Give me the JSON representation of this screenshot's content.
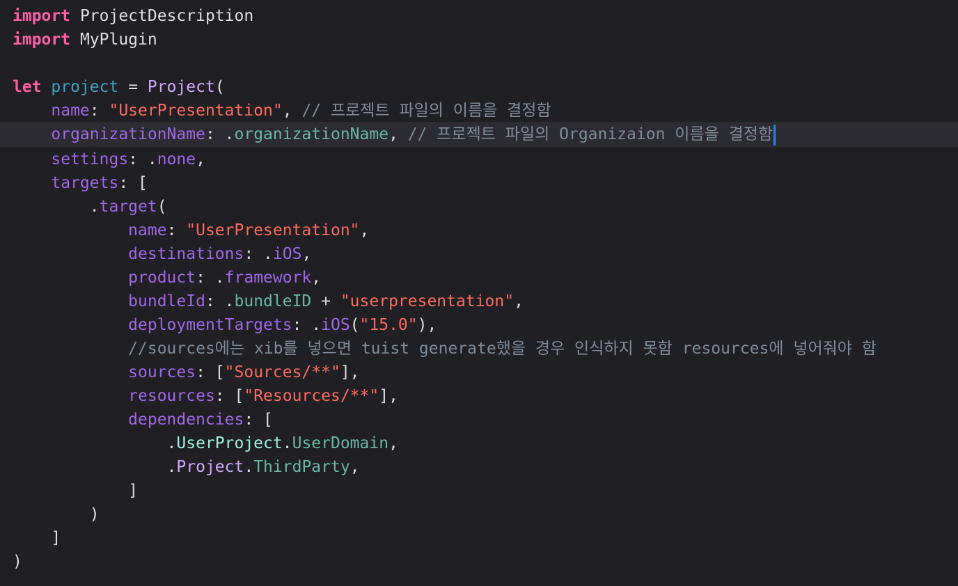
{
  "editor": {
    "cursor_line": 5,
    "colors": {
      "background": "#1f1f24",
      "current_line": "#2b2b31",
      "keyword": "#fc5fa3",
      "string": "#fc6a5d",
      "comment": "#7f8c98",
      "parameter": "#a167e6",
      "cursor": "#2b7fff"
    },
    "lines": [
      [
        [
          "kw",
          "import"
        ],
        [
          "plain",
          " ProjectDescription"
        ]
      ],
      [
        [
          "kw",
          "import"
        ],
        [
          "plain",
          " MyPlugin"
        ]
      ],
      [],
      [
        [
          "kw",
          "let"
        ],
        [
          "plain",
          " "
        ],
        [
          "decl",
          "project"
        ],
        [
          "plain",
          " = "
        ],
        [
          "cls",
          "Project"
        ],
        [
          "plain",
          "("
        ]
      ],
      [
        [
          "plain",
          "    "
        ],
        [
          "param",
          "name"
        ],
        [
          "plain",
          ": "
        ],
        [
          "str",
          "\"UserPresentation\""
        ],
        [
          "plain",
          ", "
        ],
        [
          "cmt",
          "// 프로젝트 파일의 이름을 결정함"
        ]
      ],
      [
        [
          "plain",
          "    "
        ],
        [
          "param",
          "organizationName"
        ],
        [
          "plain",
          ": ."
        ],
        [
          "enum",
          "organizationName"
        ],
        [
          "plain",
          ", "
        ],
        [
          "cmt",
          "// 프로젝트 파일의 Organizaion 이름을 결정함"
        ]
      ],
      [
        [
          "plain",
          "    "
        ],
        [
          "param",
          "settings"
        ],
        [
          "plain",
          ": ."
        ],
        [
          "param",
          "none"
        ],
        [
          "plain",
          ","
        ]
      ],
      [
        [
          "plain",
          "    "
        ],
        [
          "param",
          "targets"
        ],
        [
          "plain",
          ": ["
        ]
      ],
      [
        [
          "plain",
          "        ."
        ],
        [
          "param",
          "target"
        ],
        [
          "plain",
          "("
        ]
      ],
      [
        [
          "plain",
          "            "
        ],
        [
          "param",
          "name"
        ],
        [
          "plain",
          ": "
        ],
        [
          "str",
          "\"UserPresentation\""
        ],
        [
          "plain",
          ","
        ]
      ],
      [
        [
          "plain",
          "            "
        ],
        [
          "param",
          "destinations"
        ],
        [
          "plain",
          ": ."
        ],
        [
          "param",
          "iOS"
        ],
        [
          "plain",
          ","
        ]
      ],
      [
        [
          "plain",
          "            "
        ],
        [
          "param",
          "product"
        ],
        [
          "plain",
          ": ."
        ],
        [
          "param",
          "framework"
        ],
        [
          "plain",
          ","
        ]
      ],
      [
        [
          "plain",
          "            "
        ],
        [
          "param",
          "bundleId"
        ],
        [
          "plain",
          ": ."
        ],
        [
          "enum",
          "bundleID"
        ],
        [
          "plain",
          " + "
        ],
        [
          "str",
          "\"userpresentation\""
        ],
        [
          "plain",
          ","
        ]
      ],
      [
        [
          "plain",
          "            "
        ],
        [
          "param",
          "deploymentTargets"
        ],
        [
          "plain",
          ": ."
        ],
        [
          "param",
          "iOS"
        ],
        [
          "plain",
          "("
        ],
        [
          "str",
          "\"15.0\""
        ],
        [
          "plain",
          "),"
        ]
      ],
      [
        [
          "plain",
          "            "
        ],
        [
          "cmt",
          "//sources에는 xib를 넣으면 tuist generate했을 경우 인식하지 못함 resources에 넣어줘야 함"
        ]
      ],
      [
        [
          "plain",
          "            "
        ],
        [
          "param",
          "sources"
        ],
        [
          "plain",
          ": ["
        ],
        [
          "str",
          "\"Sources/**\""
        ],
        [
          "plain",
          "],"
        ]
      ],
      [
        [
          "plain",
          "            "
        ],
        [
          "param",
          "resources"
        ],
        [
          "plain",
          ": ["
        ],
        [
          "str",
          "\"Resources/**\""
        ],
        [
          "plain",
          "],"
        ]
      ],
      [
        [
          "plain",
          "            "
        ],
        [
          "param",
          "dependencies"
        ],
        [
          "plain",
          ": ["
        ]
      ],
      [
        [
          "plain",
          "                ."
        ],
        [
          "proj",
          "UserProject"
        ],
        [
          "plain",
          "."
        ],
        [
          "enum",
          "UserDomain"
        ],
        [
          "plain",
          ","
        ]
      ],
      [
        [
          "plain",
          "                ."
        ],
        [
          "cls",
          "Project"
        ],
        [
          "plain",
          "."
        ],
        [
          "enum",
          "ThirdParty"
        ],
        [
          "plain",
          ","
        ]
      ],
      [
        [
          "plain",
          "            ]"
        ]
      ],
      [
        [
          "plain",
          "        )"
        ]
      ],
      [
        [
          "plain",
          "    ]"
        ]
      ],
      [
        [
          "plain",
          ")"
        ]
      ]
    ]
  }
}
